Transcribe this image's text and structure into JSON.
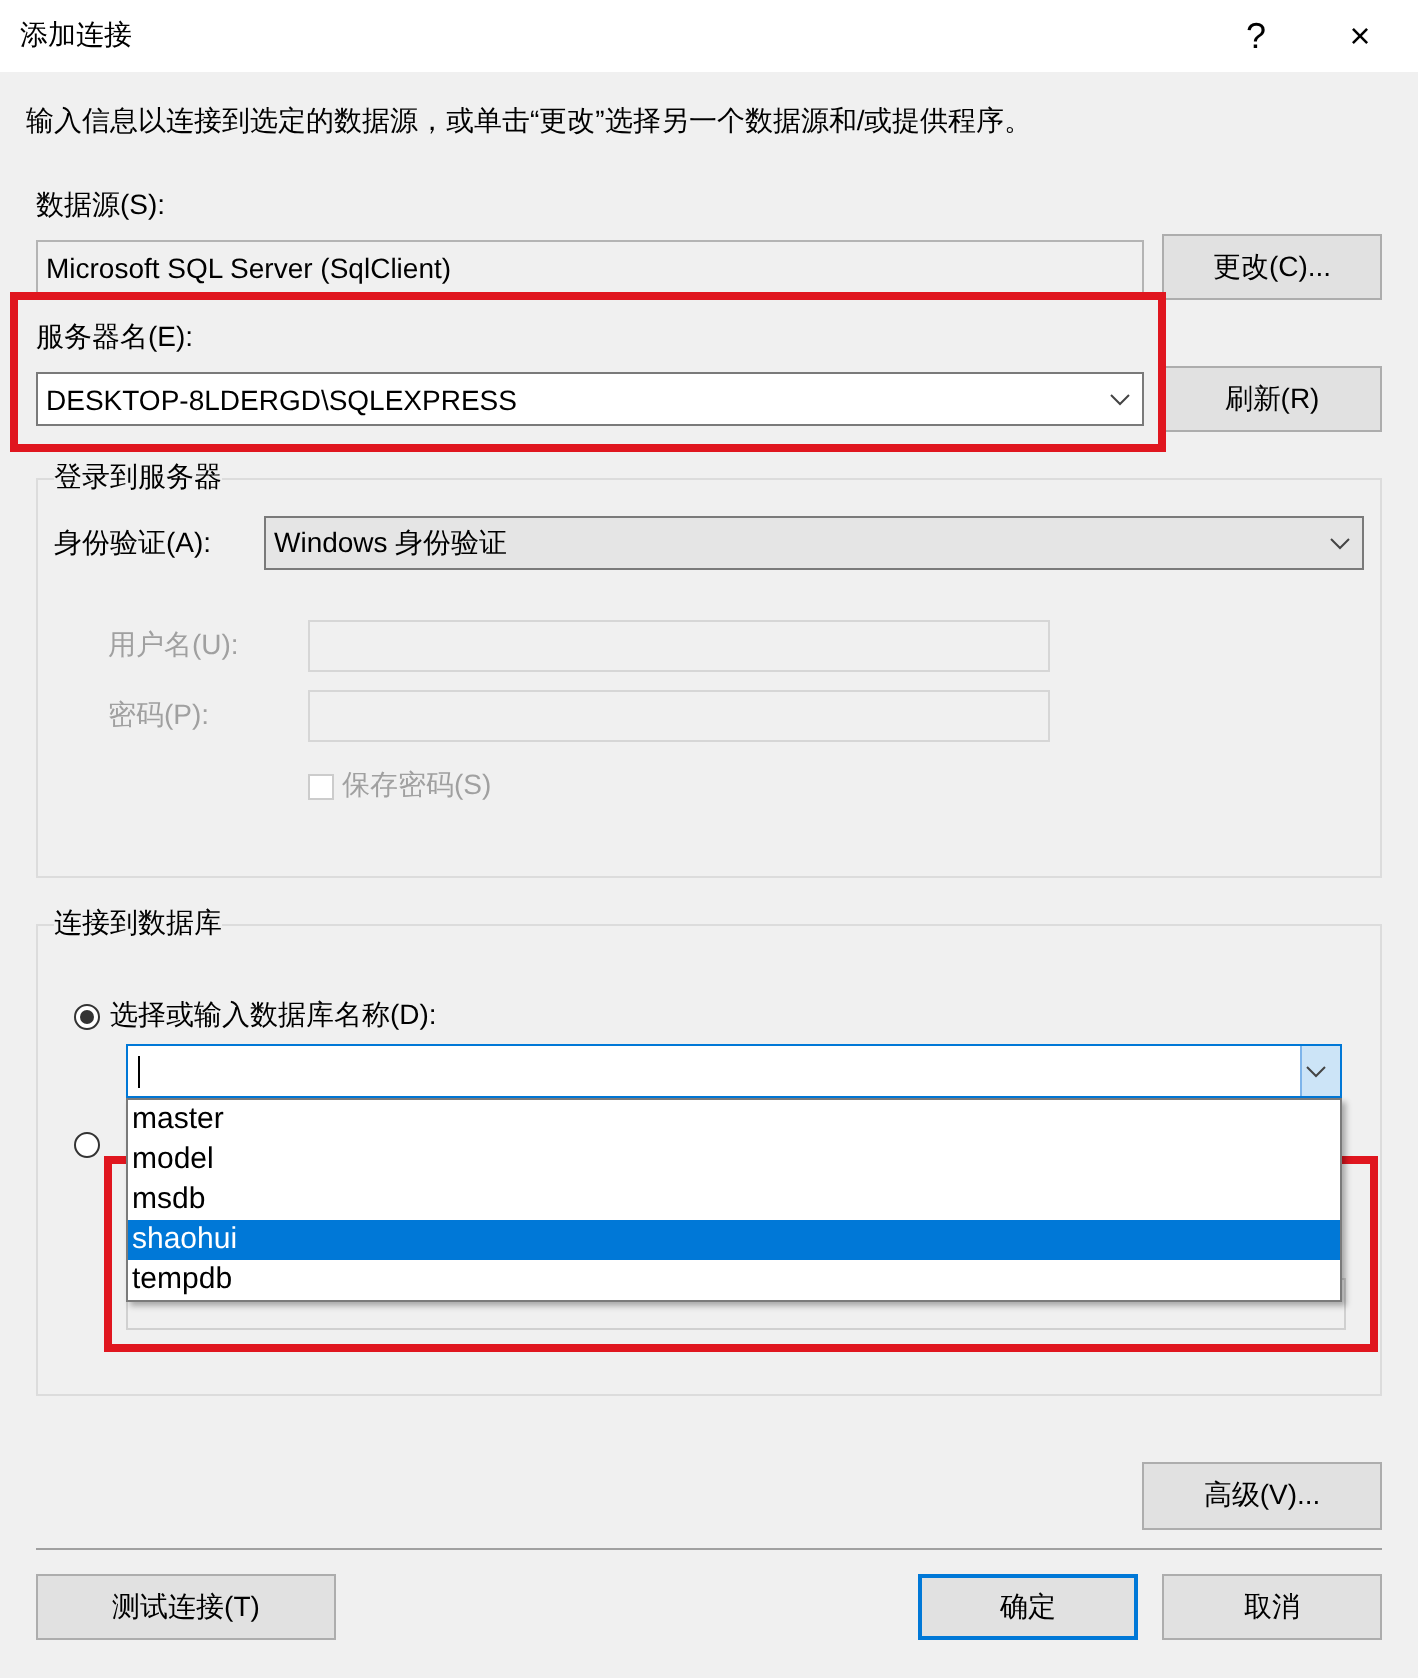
{
  "window": {
    "title": "添加连接",
    "help": "?",
    "close": "×"
  },
  "intro": "输入信息以连接到选定的数据源，或单击“更改”选择另一个数据源和/或提供程序。",
  "data_source": {
    "label": "数据源(S):",
    "value": "Microsoft SQL Server (SqlClient)",
    "button": "更改(C)..."
  },
  "server": {
    "label": "服务器名(E):",
    "value": "DESKTOP-8LDERGD\\SQLEXPRESS",
    "button": "刷新(R)",
    "highlighted": true
  },
  "login_group": {
    "title": "登录到服务器",
    "auth": {
      "label": "身份验证(A):",
      "value": "Windows 身份验证"
    },
    "fields": [
      {
        "label": "用户名(U):",
        "disabled": true
      },
      {
        "label": "密码(P):",
        "disabled": true
      }
    ],
    "save_password": {
      "label": "保存密码(S)",
      "checked": false,
      "disabled": true
    }
  },
  "database_group": {
    "title": "连接到数据库",
    "options": [
      {
        "label": "选择或输入数据库名称(D):",
        "selected": true
      },
      {
        "selected": false
      }
    ],
    "dropdown": {
      "highlighted": true,
      "items": [
        {
          "label": "master",
          "selected": false
        },
        {
          "label": "model",
          "selected": false
        },
        {
          "label": "msdb",
          "selected": false
        },
        {
          "label": "shaohui",
          "selected": true
        },
        {
          "label": "tempdb",
          "selected": false
        }
      ]
    }
  },
  "advanced_button": "高级(V)...",
  "footer": {
    "test_button": "测试连接(T)",
    "ok_button": "确定",
    "cancel_button": "取消"
  }
}
